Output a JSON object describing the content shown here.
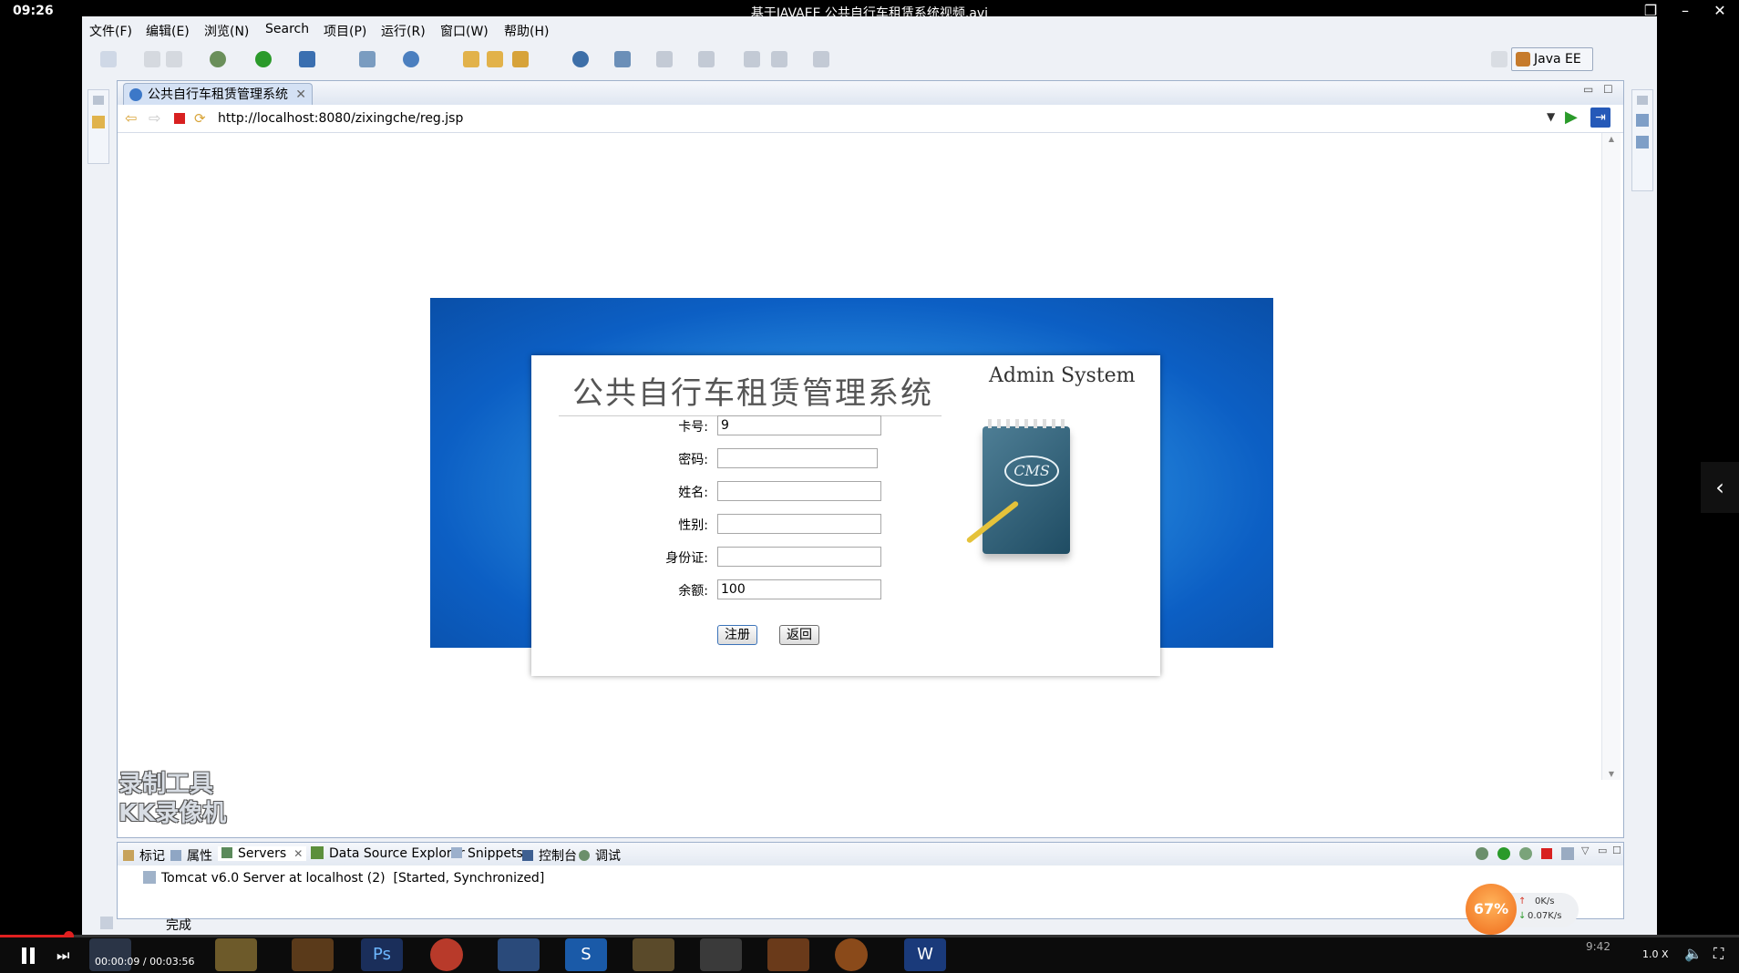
{
  "player": {
    "clock": "09:26",
    "video_title": "基于JAVAEE 公共自行车租赁系统视频.avi",
    "time_display": "00:00:09 / 00:03:56",
    "speed": "1.0 X",
    "progress_fraction": 0.04
  },
  "menu": [
    "文件(F)",
    "编辑(E)",
    "浏览(N)",
    "Search",
    "项目(P)",
    "运行(R)",
    "窗口(W)",
    "帮助(H)"
  ],
  "perspective": "Java EE",
  "editor": {
    "tab_title": "公共自行车租赁管理系统",
    "url": "http://localhost:8080/zixingche/reg.jsp"
  },
  "page": {
    "system_name": "公共自行车租赁管理系统",
    "admin_text": "Admin System",
    "notebook_text": "CMS",
    "fields": [
      {
        "label": "卡号:",
        "value": "9"
      },
      {
        "label": "密码:",
        "value": ""
      },
      {
        "label": "姓名:",
        "value": ""
      },
      {
        "label": "性别:",
        "value": ""
      },
      {
        "label": "身份证:",
        "value": ""
      },
      {
        "label": "余额:",
        "value": "100"
      }
    ],
    "register_button": "注册",
    "back_button": "返回"
  },
  "bottom_panel": {
    "tabs": [
      "标记",
      "属性",
      "Servers",
      "Data Source Explorer",
      "Snippets",
      "控制台",
      "调试"
    ],
    "server_entry": "Tomcat v6.0 Server at localhost (2)",
    "server_state": "[Started, Synchronized]"
  },
  "status_text": "完成",
  "watermark": [
    "录制工具",
    "KK录像机"
  ],
  "net_widget": {
    "percent": "67%",
    "upload": "0K/s",
    "download": "0.07K/s"
  },
  "tray_time": "9:42",
  "colors": {
    "accent_blue": "#0c5fc4",
    "progress_red": "#e02020",
    "widget_orange": "#ef6a1a"
  }
}
